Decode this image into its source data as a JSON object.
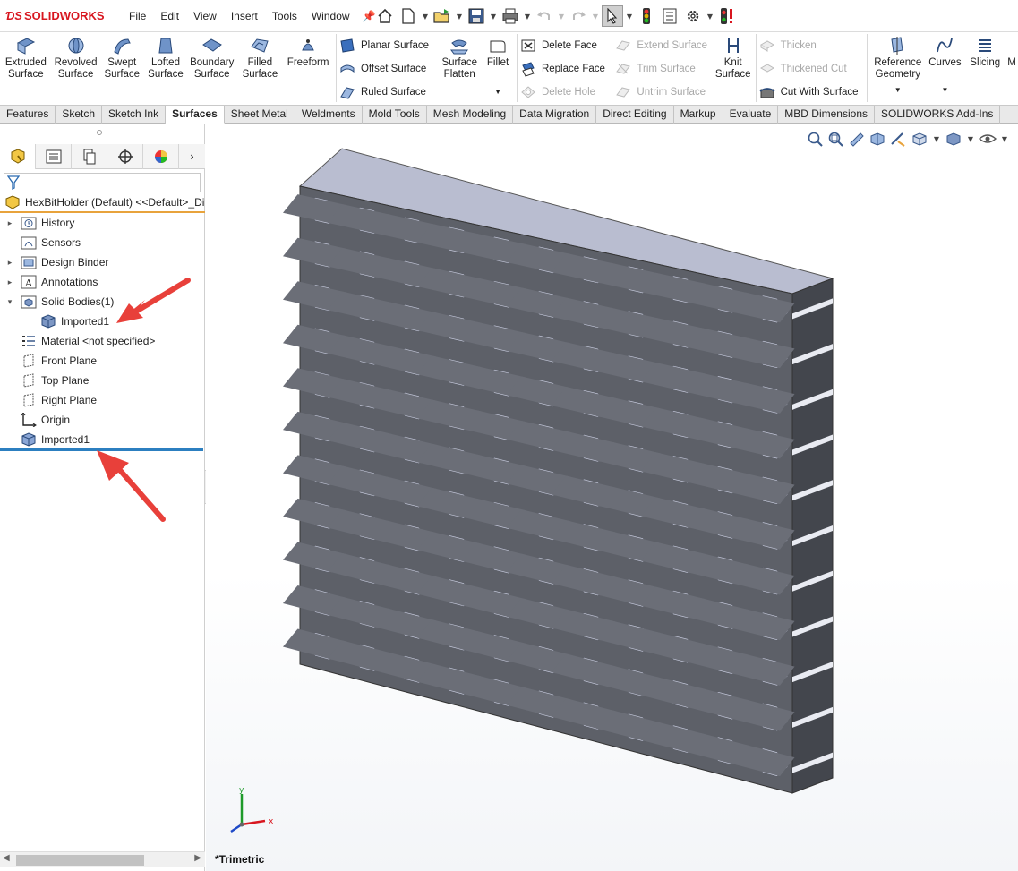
{
  "app": {
    "brand": "SOLIDWORKS",
    "brand_color": "#d8161f"
  },
  "menu": [
    "File",
    "Edit",
    "View",
    "Insert",
    "Tools",
    "Window"
  ],
  "ribbon": {
    "big1": [
      {
        "label1": "Extruded",
        "label2": "Surface"
      },
      {
        "label1": "Revolved",
        "label2": "Surface"
      },
      {
        "label1": "Swept",
        "label2": "Surface"
      },
      {
        "label1": "Lofted",
        "label2": "Surface"
      },
      {
        "label1": "Boundary",
        "label2": "Surface"
      },
      {
        "label1": "Filled",
        "label2": "Surface"
      },
      {
        "label1": "Freeform",
        "label2": ""
      }
    ],
    "col1": [
      "Planar Surface",
      "Offset Surface",
      "Ruled Surface"
    ],
    "flatten": {
      "label1": "Surface",
      "label2": "Flatten"
    },
    "fillet": "Fillet",
    "col2": [
      "Delete Face",
      "Replace Face",
      "Delete Hole"
    ],
    "col3": [
      "Extend Surface",
      "Trim Surface",
      "Untrim Surface"
    ],
    "knit": {
      "label1": "Knit",
      "label2": "Surface"
    },
    "col4": [
      "Thicken",
      "Thickened Cut",
      "Cut With Surface"
    ],
    "refgeo": {
      "label1": "Reference",
      "label2": "Geometry"
    },
    "curves": "Curves",
    "slicing": "Slicing",
    "more": "M"
  },
  "tabs": [
    "Features",
    "Sketch",
    "Sketch Ink",
    "Surfaces",
    "Sheet Metal",
    "Weldments",
    "Mold Tools",
    "Mesh Modeling",
    "Data Migration",
    "Direct Editing",
    "Markup",
    "Evaluate",
    "MBD Dimensions",
    "SOLIDWORKS Add-Ins"
  ],
  "active_tab": "Surfaces",
  "tree": {
    "root": "HexBitHolder  (Default) <<Default>_Di",
    "items": [
      {
        "label": "History",
        "expander": "▸",
        "indent": 0,
        "icon": "history-folder-icon"
      },
      {
        "label": "Sensors",
        "expander": "",
        "indent": 0,
        "icon": "sensors-folder-icon"
      },
      {
        "label": "Design Binder",
        "expander": "▸",
        "indent": 0,
        "icon": "design-binder-icon"
      },
      {
        "label": "Annotations",
        "expander": "▸",
        "indent": 0,
        "icon": "annotations-icon"
      },
      {
        "label": "Solid Bodies(1)",
        "expander": "▾",
        "indent": 0,
        "icon": "solid-bodies-folder-icon"
      },
      {
        "label": "Imported1",
        "expander": "",
        "indent": 1,
        "icon": "solid-body-icon"
      },
      {
        "label": "Material <not specified>",
        "expander": "",
        "indent": 0,
        "icon": "material-icon"
      },
      {
        "label": "Front Plane",
        "expander": "",
        "indent": 0,
        "icon": "plane-icon"
      },
      {
        "label": "Top Plane",
        "expander": "",
        "indent": 0,
        "icon": "plane-icon"
      },
      {
        "label": "Right Plane",
        "expander": "",
        "indent": 0,
        "icon": "plane-icon"
      },
      {
        "label": "Origin",
        "expander": "",
        "indent": 0,
        "icon": "origin-icon"
      },
      {
        "label": "Imported1",
        "expander": "",
        "indent": 0,
        "icon": "imported-feature-icon"
      }
    ]
  },
  "viewport": {
    "view_label": "*Trimetric",
    "axis_x": "x",
    "axis_y": "y"
  },
  "colors": {
    "annotation_arrow": "#e8403a",
    "rollback_bar": "#2c7fc0",
    "model_face": "#5d6068",
    "model_top": "#b9bdd0"
  }
}
